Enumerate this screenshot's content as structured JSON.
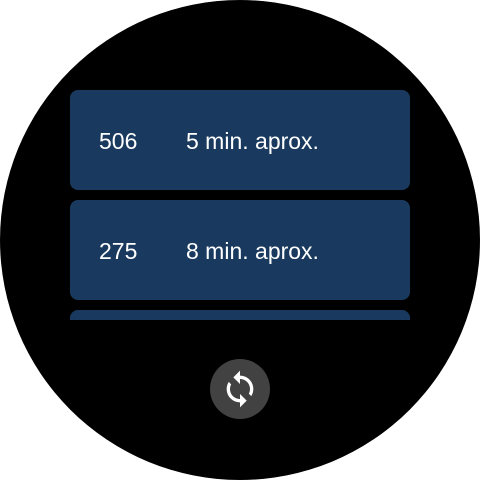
{
  "colors": {
    "background": "#000000",
    "card": "#193a5e",
    "button_bg": "#424242",
    "icon": "#ffffff"
  },
  "arrivals": [
    {
      "line": "506",
      "eta": "5 min. aprox."
    },
    {
      "line": "275",
      "eta": "8 min. aprox."
    },
    {
      "line": "",
      "eta": ""
    }
  ],
  "refresh": {
    "icon": "refresh-icon"
  }
}
